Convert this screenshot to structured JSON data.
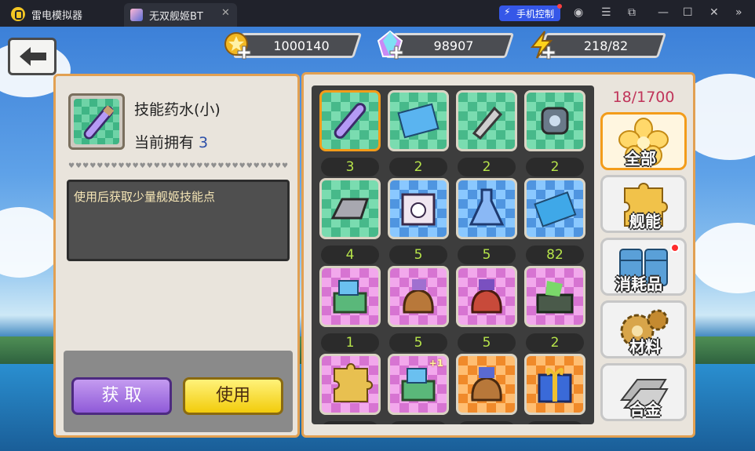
{
  "window": {
    "app_name": "雷电模拟器",
    "tab_title": "无双舰姬BT",
    "phone_control_label": "手机控制",
    "icons": [
      "user-icon",
      "menu-icon",
      "popout-icon",
      "minimize-icon",
      "maximize-icon",
      "close-icon",
      "collapse-icon"
    ]
  },
  "resources": {
    "gold": "1000140",
    "crystal": "98907",
    "energy": "218/82"
  },
  "detail": {
    "name": "技能药水(小)",
    "own_label": "当前拥有",
    "own_count": "3",
    "description": "使用后获取少量舰姬技能点",
    "get_button": "获 取",
    "use_button": "使用"
  },
  "inventory": {
    "capacity": "18/1700",
    "items": [
      {
        "icon": "potion-icon",
        "bg": "green",
        "count": "3",
        "selected": true
      },
      {
        "icon": "blueprint-icon",
        "bg": "green",
        "count": "2"
      },
      {
        "icon": "shell-icon",
        "bg": "green",
        "count": "2"
      },
      {
        "icon": "engine-part-icon",
        "bg": "green",
        "count": "2"
      },
      {
        "icon": "steel-ingot-icon",
        "bg": "green",
        "count": "4"
      },
      {
        "icon": "gift-box-icon",
        "bg": "blue",
        "count": "5"
      },
      {
        "icon": "flask-icon",
        "bg": "blue",
        "count": "5"
      },
      {
        "icon": "blue-paper-icon",
        "bg": "blue",
        "count": "82"
      },
      {
        "icon": "supply-box-icon",
        "bg": "purple",
        "count": "1"
      },
      {
        "icon": "supply-bag-icon",
        "bg": "purple",
        "count": "5"
      },
      {
        "icon": "red-bag-icon",
        "bg": "purple",
        "count": "5"
      },
      {
        "icon": "tool-chest-icon",
        "bg": "purple",
        "count": "2"
      },
      {
        "icon": "puzzle-icon",
        "bg": "purple",
        "count": ""
      },
      {
        "icon": "supply-box-plus-icon",
        "bg": "purple",
        "count": "",
        "badge": "+1"
      },
      {
        "icon": "supply-bag-orange-icon",
        "bg": "orange",
        "count": ""
      },
      {
        "icon": "gift-icon",
        "bg": "orange",
        "count": ""
      }
    ]
  },
  "categories": [
    {
      "label": "全部",
      "icon": "flower-icon",
      "active": true
    },
    {
      "label": "舰能",
      "icon": "puzzle-icon"
    },
    {
      "label": "消耗品",
      "icon": "barrels-icon",
      "notify": true
    },
    {
      "label": "材料",
      "icon": "gears-icon"
    },
    {
      "label": "合金",
      "icon": "alloy-icon"
    }
  ],
  "colors": {
    "panel_border": "#e2a052",
    "capacity_text": "#c0345a",
    "count_text": "#b6e34a",
    "get_button": "#9b63dd",
    "use_button": "#f5d21a",
    "phone_control": "#3557e8"
  }
}
